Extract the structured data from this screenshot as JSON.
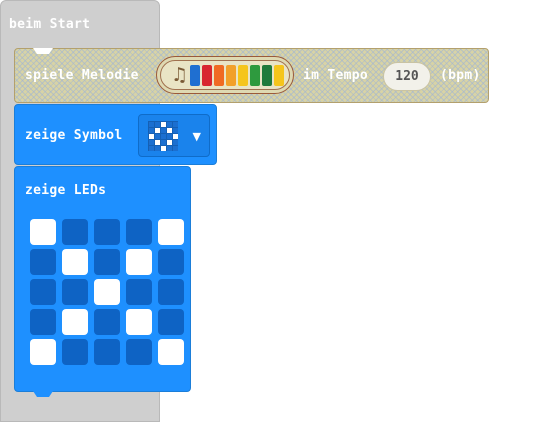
{
  "on_start": {
    "label": "beim Start"
  },
  "play_melody": {
    "label": "spiele Melodie",
    "tempo_label": "im Tempo",
    "tempo_value": "120",
    "unit_label": "(bpm)",
    "note_icon": "music-note-icon",
    "note_colors": [
      "#1f6fd1",
      "#d8262f",
      "#f06a23",
      "#f2a02a",
      "#f5c51c",
      "#2e9a3e",
      "#1f7a3b",
      "#f5c51c"
    ]
  },
  "show_icon": {
    "label": "zeige Symbol",
    "selected_icon": "diamond",
    "preview": [
      [
        0,
        0,
        1,
        0,
        0
      ],
      [
        0,
        1,
        0,
        1,
        0
      ],
      [
        1,
        0,
        0,
        0,
        1
      ],
      [
        0,
        1,
        0,
        1,
        0
      ],
      [
        0,
        0,
        1,
        0,
        0
      ]
    ]
  },
  "show_leds": {
    "label": "zeige LEDs",
    "leds": [
      [
        1,
        0,
        0,
        0,
        1
      ],
      [
        0,
        1,
        0,
        1,
        0
      ],
      [
        0,
        0,
        1,
        0,
        0
      ],
      [
        0,
        1,
        0,
        1,
        0
      ],
      [
        1,
        0,
        0,
        0,
        1
      ]
    ]
  }
}
